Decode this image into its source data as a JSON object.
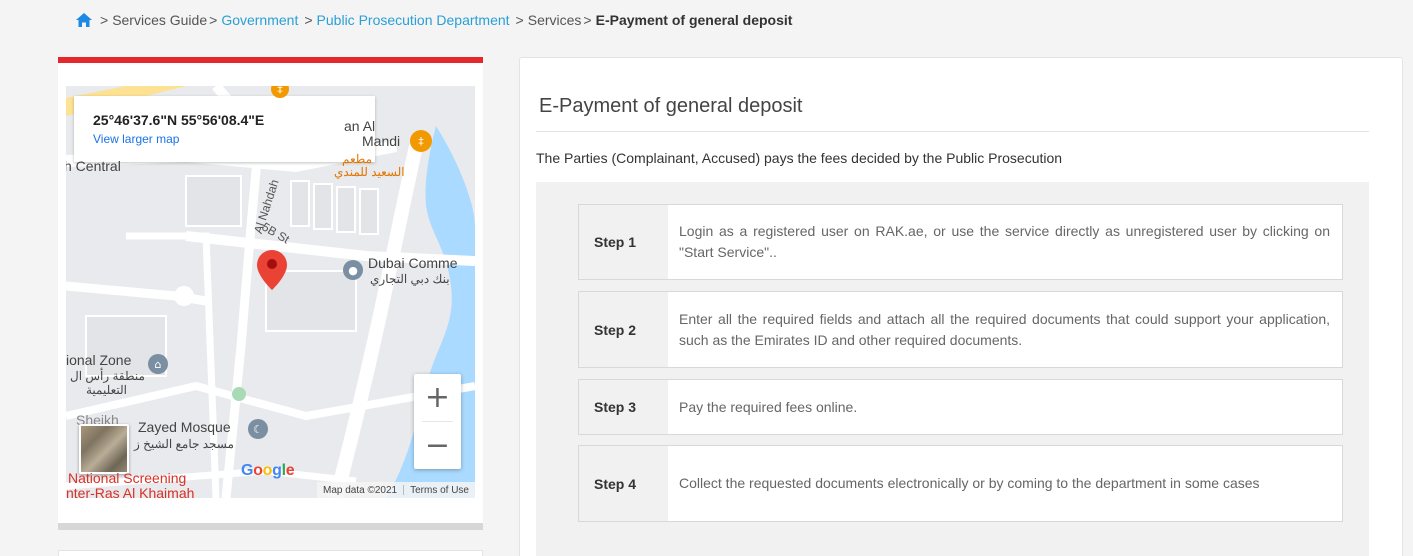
{
  "breadcrumb": {
    "home_icon": "home-icon",
    "items": [
      {
        "label": "Services Guide",
        "link": false
      },
      {
        "label": "Government",
        "link": true
      },
      {
        "label": "Public Prosecution Department",
        "link": true
      },
      {
        "label": "Services",
        "link": false
      }
    ],
    "current": "E-Payment of general deposit"
  },
  "map": {
    "coordinates": "25°46'37.6\"N 55°56'08.4\"E",
    "view_larger": "View larger map",
    "zoom_in": "+",
    "zoom_out": "−",
    "google": [
      "G",
      "o",
      "o",
      "g",
      "l",
      "e"
    ],
    "map_data": "Map data ©2021",
    "terms": "Terms of Use",
    "labels": {
      "an_al": "an Al",
      "mandi": "Mandi",
      "restaurant_ar_1": "مطعم",
      "restaurant_ar_2": "السعيد للمندي",
      "central": "h Central",
      "nahdah": "Al Nahdah",
      "street": "5B St",
      "dubai_comm": "Dubai Comme",
      "dubai_comm_ar": "بنك دبي التجاري",
      "zone": "ional Zone",
      "zone_ar_1": "منطقة رأس ال",
      "zone_ar_2": "التعليمية",
      "mosque": "Zayed Mosque",
      "mosque_prefix": "Sheikh",
      "mosque_ar": "مسجد جامع الشيخ ز",
      "screening": "National Screening",
      "screening_2": "nter-Ras Al Khaimah"
    }
  },
  "service": {
    "title": "E-Payment of general deposit",
    "description": "The Parties (Complainant, Accused) pays the fees decided by the Public Prosecution",
    "steps": [
      {
        "label": "Step 1",
        "text": "Login as a registered user on RAK.ae, or use the service directly as unregistered user by clicking on \"Start Service\".."
      },
      {
        "label": "Step 2",
        "text": "Enter all the required fields and attach all the required documents that could support your application, such as the Emirates ID and other required documents."
      },
      {
        "label": "Step 3",
        "text": "Pay the required fees online."
      },
      {
        "label": "Step 4",
        "text": "Collect the requested documents electronically or by coming to the department in some cases"
      }
    ]
  },
  "colors": {
    "accent_red": "#e5262a",
    "link_blue": "#2a9fd6",
    "map_pin": "#ea4335"
  }
}
